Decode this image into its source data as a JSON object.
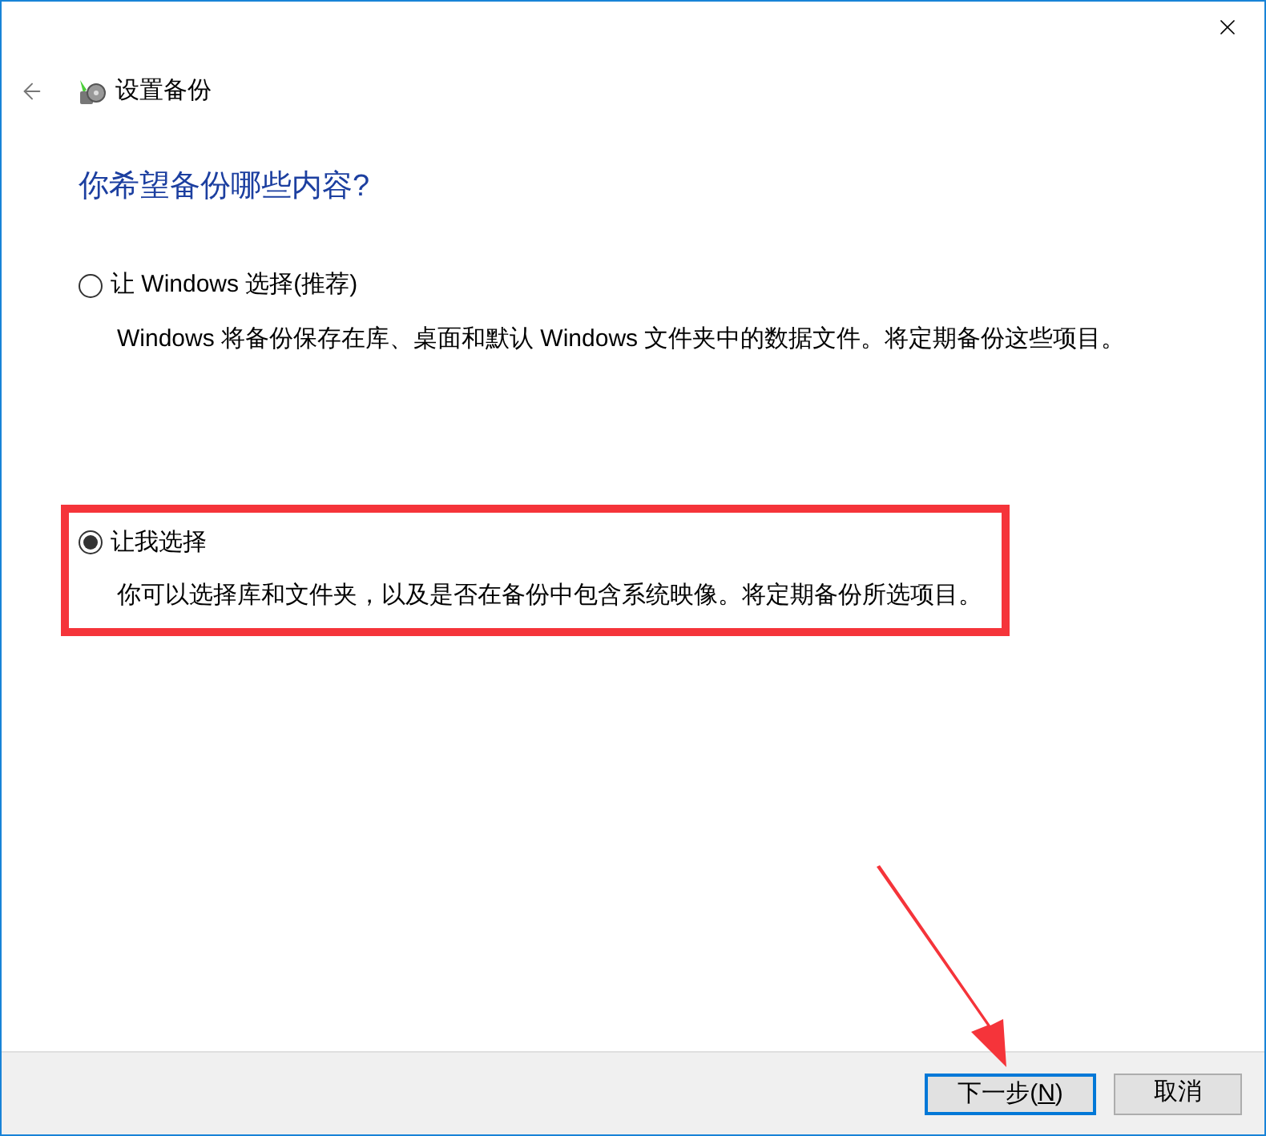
{
  "window": {
    "title": "设置备份"
  },
  "heading": "你希望备份哪些内容?",
  "options": [
    {
      "label": "让 Windows 选择(推荐)",
      "description": "Windows 将备份保存在库、桌面和默认 Windows 文件夹中的数据文件。将定期备份这些项目。",
      "selected": false
    },
    {
      "label": "让我选择",
      "description": "你可以选择库和文件夹，以及是否在备份中包含系统映像。将定期备份所选项目。",
      "selected": true
    }
  ],
  "buttons": [
    {
      "label_before": "下一步(",
      "accelerator": "N",
      "label_after": ")",
      "default": true
    },
    {
      "label_before": "取消",
      "default": false
    }
  ]
}
